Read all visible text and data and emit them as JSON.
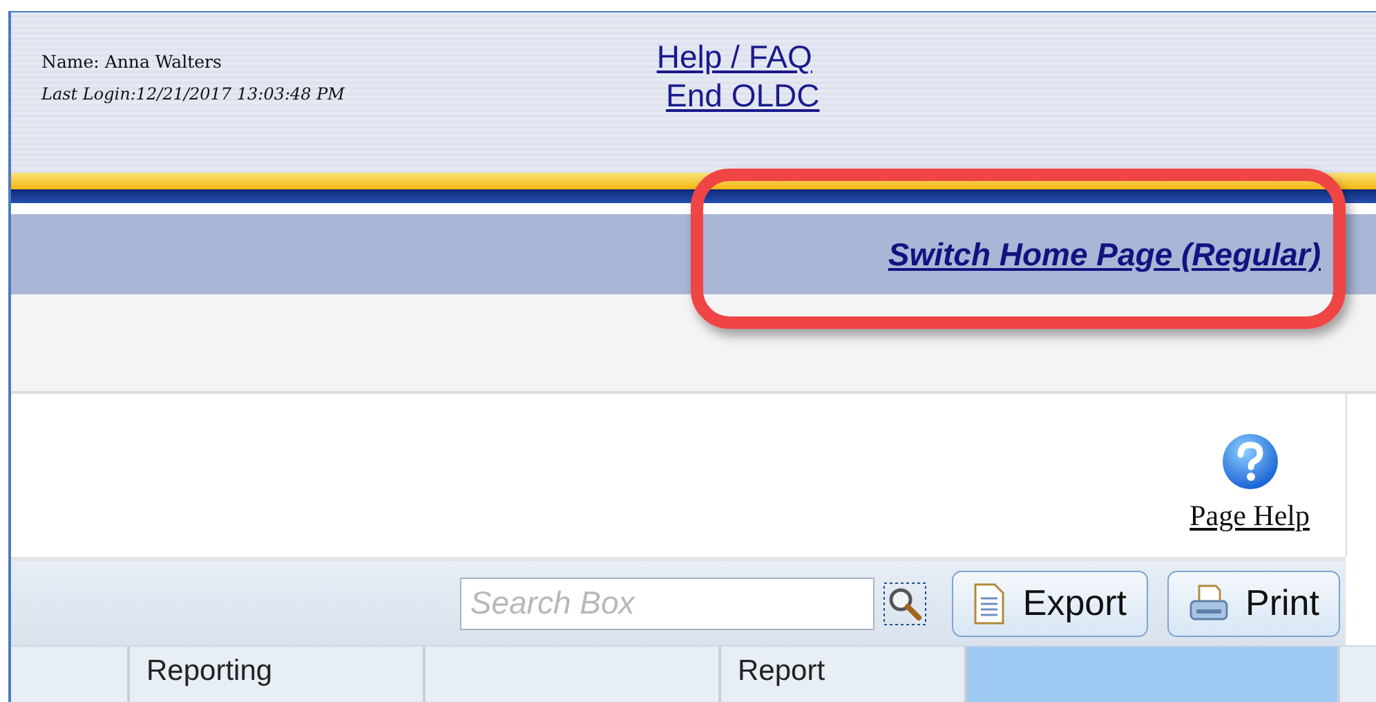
{
  "user": {
    "name": "Name: Anna Walters",
    "last_login": "Last Login:12/21/2017 13:03:48 PM"
  },
  "header_links": [
    "Help / FAQ",
    "End OLDC"
  ],
  "switch_link": "Switch Home Page (Regular)",
  "page_help": "Page Help",
  "toolbar": {
    "search": {
      "placeholder": "Search Box"
    },
    "buttons": [
      {
        "label": "Export",
        "kind": "export"
      },
      {
        "label": "Print",
        "kind": "print"
      }
    ]
  },
  "table": {
    "columns": [
      {
        "selected": false
      },
      {
        "label": "Reporting",
        "selected": false
      },
      {
        "selected": false
      },
      {
        "label": "Report",
        "selected": false
      },
      {
        "selected": true
      }
    ]
  }
}
